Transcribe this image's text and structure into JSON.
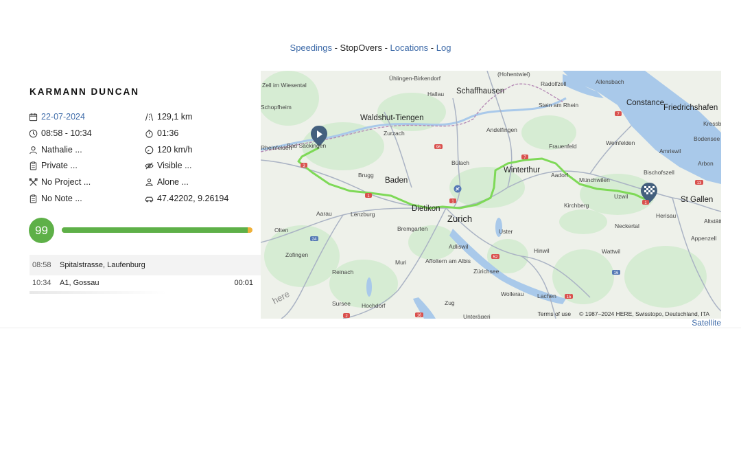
{
  "nav": {
    "speedings": "Speedings",
    "sep1": " - ",
    "stopovers": "StopOvers",
    "sep2": " - ",
    "locations": "Locations",
    "sep3": " - ",
    "log": "Log"
  },
  "driver": {
    "name": "KARMANN DUNCAN"
  },
  "info": {
    "date": "22-07-2024",
    "distance": "129,1 km",
    "time_range": "08:58 - 10:34",
    "duration": "01:36",
    "user": "Nathalie ...",
    "max_speed": "120 km/h",
    "trip_type": "Private ...",
    "visibility": "Visible ...",
    "project": "No Project ...",
    "company": "Alone ...",
    "note": "No Note ...",
    "coordinates": "47.42202, 9.26194"
  },
  "score": {
    "value": "99",
    "fraction": 0.975
  },
  "stops": [
    {
      "time": "08:58",
      "place": "Spitalstrasse, Laufenburg",
      "duration": ""
    },
    {
      "time": "10:34",
      "place": "A1, Gossau",
      "duration": "00:01"
    }
  ],
  "map": {
    "provider_logo": "here",
    "terms": "Terms of use",
    "copyright": "© 1987–2024 HERE, Swisstopo, Deutschland, ITA",
    "satellite": "Satellite",
    "route_color": "#7ed957",
    "water_color": "#a9c9ea",
    "cities": {
      "zurich": "Zurich",
      "st_gallen": "St Gallen",
      "constance": "Constance",
      "friedrichshafen": "Friedrichshafen",
      "winterthur": "Winterthur",
      "baden": "Baden",
      "dietikon": "Dietikon",
      "schaffhausen": "Schaffhausen",
      "waldshut": "Waldshut-Tiengen"
    },
    "towns": {
      "zell": "Zell im Wiesental",
      "uehlingen": "Ühlingen-Birkendorf",
      "hohentwiel": "(Hohentwiel)",
      "allensbach": "Allensbach",
      "radolfzell": "Radolfzell",
      "steinamrhein": "Stein am Rhein",
      "kressbronn": "Kressb",
      "bodensee": "Bodensee",
      "arbon": "Arbon",
      "amriswil": "Amriswil",
      "bischofszell": "Bischofszell",
      "weinfelden": "Weinfelden",
      "frauenfeld": "Frauenfeld",
      "andelfingen": "Andelfingen",
      "hallau": "Hallau",
      "rheinfelden": "Rheinfelden",
      "badsaeckingen": "Bad Säckingen",
      "schopfheim": "Schopfheim",
      "zurzach": "Zurzach",
      "buelach": "Bülach",
      "brugg": "Brugg",
      "aadorf": "Aadorf",
      "muenchwilen": "Münchwilen",
      "uzwil": "Uzwil",
      "kirchberg": "Kirchberg",
      "herisau": "Herisau",
      "altstaett": "Altstätt",
      "appenzell": "Appenzell",
      "neckertal": "Neckertal",
      "wattwil": "Wattwil",
      "hinwil": "Hinwil",
      "uster": "Uster",
      "adliswil": "Adliswil",
      "affoltern": "Affoltern am Albis",
      "bremgarten": "Bremgarten",
      "lenzburg": "Lenzburg",
      "aarau": "Aarau",
      "olten": "Olten",
      "zofingen": "Zofingen",
      "muri": "Muri",
      "reinach": "Reinach",
      "hochdorf": "Hochdorf",
      "sursee": "Sursee",
      "zug": "Zug",
      "zuerichsee": "Zürichsee",
      "wollerau": "Wollerau",
      "lachen": "Lachen",
      "unteraegeri": "Unterägeri"
    }
  }
}
